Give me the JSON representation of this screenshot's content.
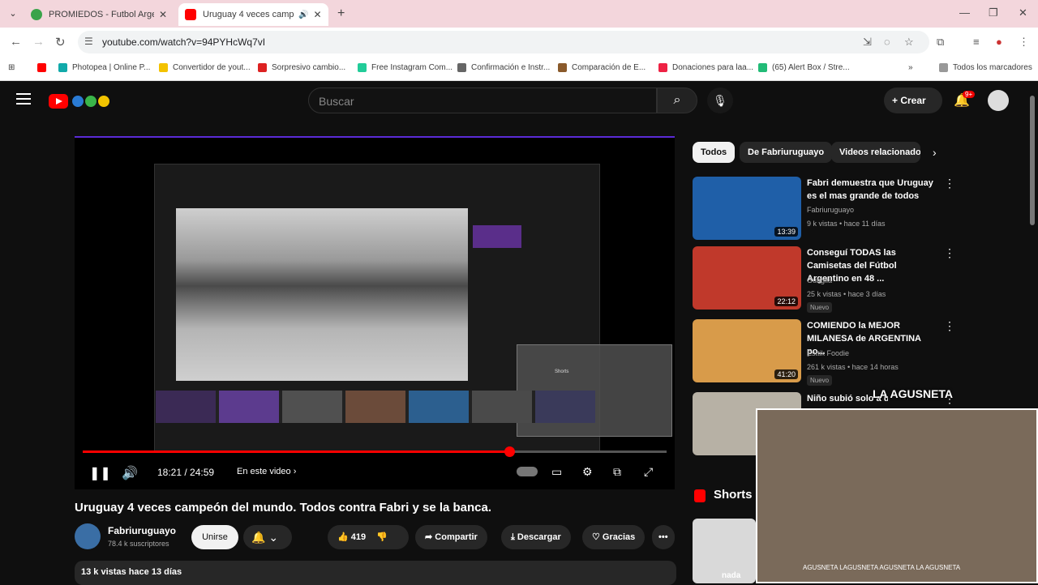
{
  "browser": {
    "tabs": [
      {
        "title": "PROMIEDOS - Futbol Argentina",
        "active": false
      },
      {
        "title": "Uruguay 4 veces campeón del mundo",
        "active": true
      }
    ],
    "url": "youtube.com/watch?v=94PYHcWq7vI",
    "bookmarks": [
      "Photopea | Online P...",
      "Convertidor de yout...",
      "Sorpresivo cambio...",
      "Free Instagram Com...",
      "Confirmación e Instr...",
      "Comparación de E...",
      "Donaciones para laa...",
      "(65) Alert Box / Stre...",
      "Todos los marcadores"
    ]
  },
  "youtube": {
    "search_placeholder": "Buscar",
    "create_label": "Crear",
    "notif_badge": "9+",
    "player": {
      "time": "18:21 / 24:59",
      "chapter": "En este video",
      "progress": 0.73,
      "inner_shorts_label": "Shorts"
    },
    "video": {
      "title": "Uruguay 4 veces campeón del mundo. Todos contra Fabri y se la banca.",
      "channel": "Fabriuruguayo",
      "subscribers": "78.4 k suscriptores",
      "join_label": "Unirse",
      "likes": "419",
      "share_label": "Compartir",
      "download_label": "Descargar",
      "thanks_label": "Gracias",
      "views_date": "13 k vistas  hace 13 días"
    },
    "chips": [
      "Todos",
      "De Fabriuruguayo",
      "Videos relacionados"
    ],
    "recommendations": [
      {
        "title": "Fabri demuestra que Uruguay es el mas grande de todos",
        "channel": "Fabriuruguayo",
        "meta": "9 k vistas • hace 11 días",
        "duration": "13:39",
        "badge": "",
        "thumb_color": "#1f5fa8"
      },
      {
        "title": "Conseguí TODAS las Camisetas del Fútbol Argentino en 48 ...",
        "channel": "Guaglia",
        "meta": "25 k vistas • hace 3 días",
        "duration": "22:12",
        "badge": "Nuevo",
        "thumb_color": "#c0392b"
      },
      {
        "title": "COMIENDO la MEJOR MILANESA de ARGENTINA po...",
        "channel": "Esttik Foodie",
        "meta": "261 k vistas • hace 14 horas",
        "duration": "41:20",
        "badge": "Nuevo",
        "thumb_color": "#d89b4a"
      },
      {
        "title": "Niño subió solo a un...",
        "channel": "",
        "meta": "",
        "duration": "",
        "badge": "",
        "thumb_color": "#b7b1a5"
      }
    ],
    "shorts_title": "Shorts",
    "shorts_thumb_label": "nada",
    "cam_logo": "LA AGUSNETA",
    "cam_footer": "AGUSNETA   LAGUSNETA   AGUSNETA   LA AGUSNETA"
  }
}
